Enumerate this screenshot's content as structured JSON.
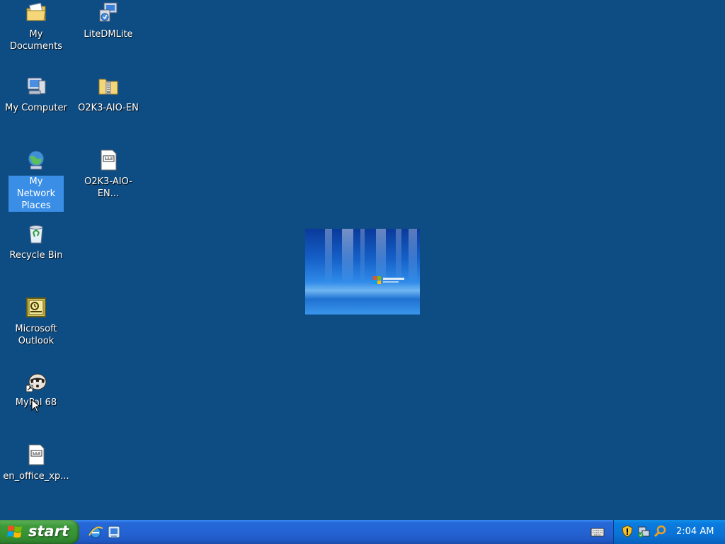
{
  "desktop": {
    "background_color": "#0e4d84",
    "icons": [
      {
        "label": "My Documents",
        "icon": "my-documents-icon"
      },
      {
        "label": "LiteDMLite",
        "icon": "installer-icon"
      },
      {
        "label": "My Computer",
        "icon": "my-computer-icon"
      },
      {
        "label": "O2K3-AIO-EN",
        "icon": "zip-folder-icon"
      },
      {
        "label": "My Network Places",
        "icon": "network-places-icon",
        "selected": true
      },
      {
        "label": "O2K3-AIO-EN...",
        "icon": "ini-file-icon"
      },
      {
        "label": "Recycle Bin",
        "icon": "recycle-bin-icon"
      },
      {
        "label": "Microsoft Outlook",
        "icon": "outlook-icon"
      },
      {
        "label": "MyPal 68",
        "icon": "mypal-icon"
      },
      {
        "label": "en_office_xp...",
        "icon": "ini-file-icon"
      }
    ]
  },
  "taskbar": {
    "start_label": "start",
    "quick_launch": [
      "internet-explorer-icon",
      "show-desktop-icon"
    ],
    "language_bar_icon": "keyboard-icon",
    "tray_icons": [
      "security-shield-icon",
      "network-status-icon",
      "search-icon"
    ],
    "clock": "2:04 AM",
    "colors": {
      "taskbar": "#2563d4",
      "start_button": "#3e9b3b",
      "tray": "#0a73d6"
    }
  }
}
